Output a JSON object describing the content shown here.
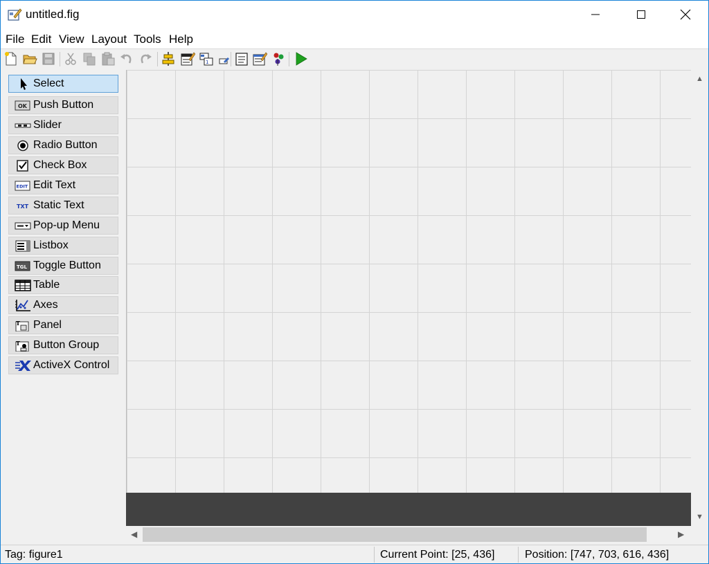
{
  "window": {
    "title": "untitled.fig"
  },
  "menu": [
    "File",
    "Edit",
    "View",
    "Layout",
    "Tools",
    "Help"
  ],
  "toolbar": [
    {
      "icon": "new-file-icon",
      "enabled": true
    },
    {
      "icon": "open-folder-icon",
      "enabled": true
    },
    {
      "icon": "save-icon",
      "enabled": false
    },
    {
      "icon": "cut-icon",
      "enabled": false
    },
    {
      "icon": "copy-icon",
      "enabled": false
    },
    {
      "icon": "paste-icon",
      "enabled": false
    },
    {
      "icon": "undo-icon",
      "enabled": false
    },
    {
      "icon": "redo-icon",
      "enabled": false
    },
    {
      "icon": "align-objects-icon",
      "enabled": true
    },
    {
      "icon": "menu-editor-icon",
      "enabled": true
    },
    {
      "icon": "tab-order-editor-icon",
      "enabled": true
    },
    {
      "icon": "toolbar-editor-icon",
      "enabled": true
    },
    {
      "icon": "editor-icon",
      "enabled": true
    },
    {
      "icon": "property-inspector-icon",
      "enabled": true
    },
    {
      "icon": "object-browser-icon",
      "enabled": true
    },
    {
      "icon": "run-icon",
      "enabled": true
    }
  ],
  "palette": [
    {
      "label": "Select",
      "icon": "arrow-cursor-icon",
      "selected": true
    },
    {
      "label": "Push Button",
      "icon": "push-button-icon",
      "icon_text": "OK"
    },
    {
      "label": "Slider",
      "icon": "slider-icon"
    },
    {
      "label": "Radio Button",
      "icon": "radio-button-icon"
    },
    {
      "label": "Check Box",
      "icon": "check-box-icon"
    },
    {
      "label": "Edit Text",
      "icon": "edit-text-icon",
      "icon_text": "EDIT"
    },
    {
      "label": "Static Text",
      "icon": "static-text-icon",
      "icon_text": "TXT"
    },
    {
      "label": "Pop-up Menu",
      "icon": "popup-menu-icon"
    },
    {
      "label": "Listbox",
      "icon": "listbox-icon"
    },
    {
      "label": "Toggle Button",
      "icon": "toggle-button-icon",
      "icon_text": "TGL"
    },
    {
      "label": "Table",
      "icon": "table-icon"
    },
    {
      "label": "Axes",
      "icon": "axes-icon"
    },
    {
      "label": "Panel",
      "icon": "panel-icon"
    },
    {
      "label": "Button Group",
      "icon": "button-group-icon"
    },
    {
      "label": "ActiveX Control",
      "icon": "activex-icon"
    }
  ],
  "status": {
    "tag": "Tag: figure1",
    "current_point": "Current Point:  [25, 436]",
    "position": "Position: [747, 703, 616, 436]"
  },
  "colors": {
    "accent_border": "#1883d7",
    "selected_bg": "#cce4f7",
    "canvas_bottom": "#414141",
    "run_green": "#1ea01e"
  }
}
